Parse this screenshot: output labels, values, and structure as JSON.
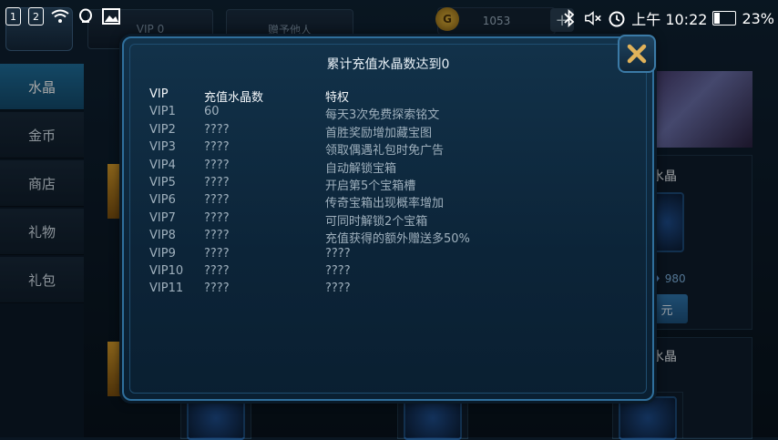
{
  "background": {
    "top_buttons": {
      "vip_label": "VIP 0",
      "gift_label": "赠予他人"
    },
    "coins": {
      "icon_glyph": "G",
      "value": "1053",
      "plus_label": "+"
    },
    "sidebar": [
      {
        "label": "水晶",
        "active": true
      },
      {
        "label": "金币",
        "active": false
      },
      {
        "label": "商店",
        "active": false
      },
      {
        "label": "礼物",
        "active": false
      },
      {
        "label": "礼包",
        "active": false
      }
    ],
    "right_cards": [
      {
        "title": "水晶",
        "price": "980",
        "button": "元"
      },
      {
        "title": "水晶"
      }
    ]
  },
  "status_bar": {
    "sim1": "1",
    "sim2": "2",
    "time": "上午 10:22",
    "battery_level": 0.23,
    "battery_percent": "23%",
    "icons": [
      "sim-1-icon",
      "sim-2-icon",
      "wifi-icon",
      "notification-icon",
      "image-icon",
      "bluetooth-icon",
      "mute-icon",
      "alarm-icon",
      "battery-icon"
    ]
  },
  "modal": {
    "title": "累计充值水晶数达到0",
    "close_icon": "close-x-icon",
    "headers": [
      "VIP",
      "充值水晶数",
      "特权"
    ],
    "rows": [
      [
        "VIP1",
        "60",
        "每天3次免费探索铭文"
      ],
      [
        "VIP2",
        "????",
        "首胜奖励增加藏宝图"
      ],
      [
        "VIP3",
        "????",
        "领取偶遇礼包时免广告"
      ],
      [
        "VIP4",
        "????",
        "自动解锁宝箱"
      ],
      [
        "VIP5",
        "????",
        "开启第5个宝箱槽"
      ],
      [
        "VIP6",
        "????",
        "传奇宝箱出现概率增加"
      ],
      [
        "VIP7",
        "????",
        "可同时解锁2个宝箱"
      ],
      [
        "VIP8",
        "????",
        "充值获得的额外赠送多50%"
      ],
      [
        "VIP9",
        "????",
        "????"
      ],
      [
        "VIP10",
        "????",
        "????"
      ],
      [
        "VIP11",
        "????",
        "????"
      ]
    ]
  },
  "colors": {
    "modal_border": "#2f6f9c",
    "header_text": "#f2f6f9",
    "row_text": "#9fb0bd",
    "close_x": "#e0b25a",
    "sidebar_active": "#1f6f9c"
  }
}
